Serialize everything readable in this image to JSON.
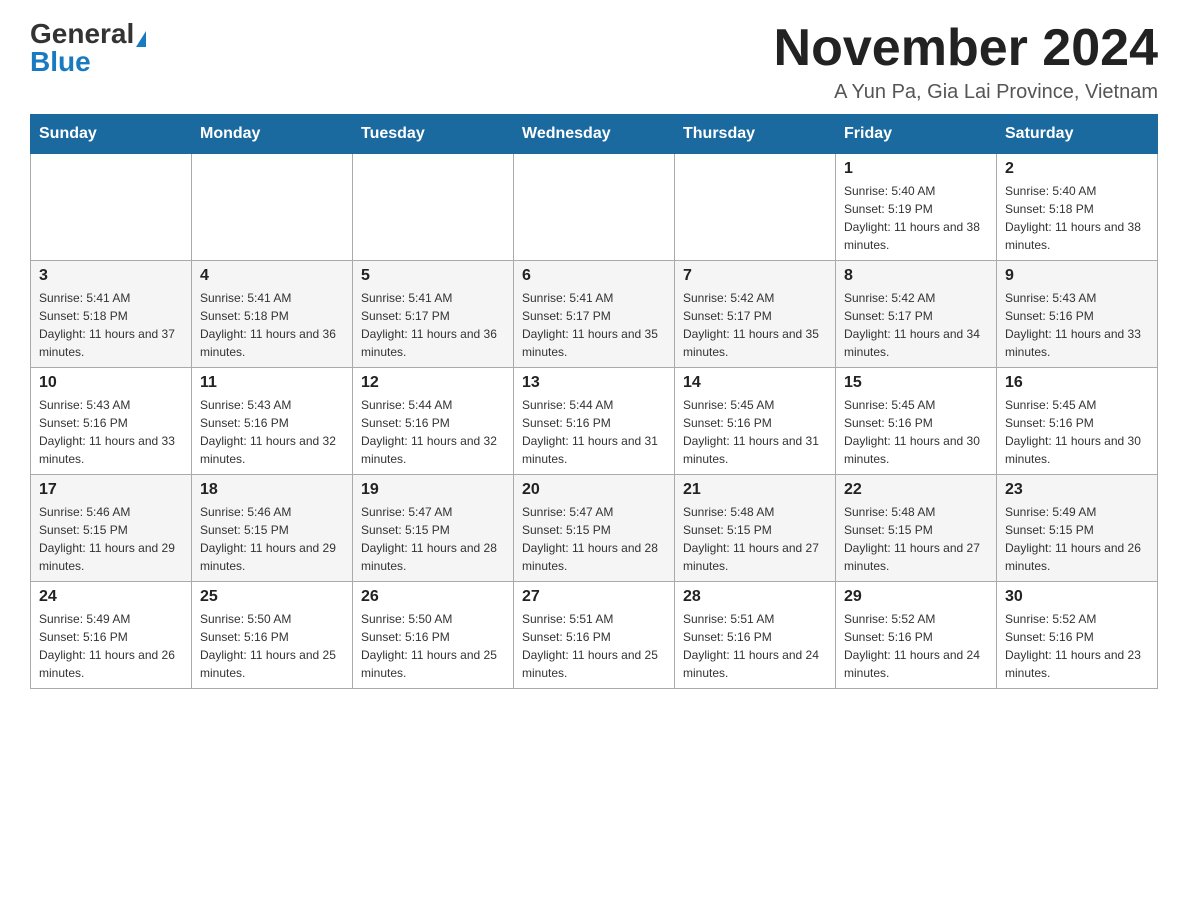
{
  "header": {
    "logo_general": "General",
    "logo_blue": "Blue",
    "month_title": "November 2024",
    "location": "A Yun Pa, Gia Lai Province, Vietnam"
  },
  "days_of_week": [
    "Sunday",
    "Monday",
    "Tuesday",
    "Wednesday",
    "Thursday",
    "Friday",
    "Saturday"
  ],
  "weeks": [
    [
      {
        "day": "",
        "info": ""
      },
      {
        "day": "",
        "info": ""
      },
      {
        "day": "",
        "info": ""
      },
      {
        "day": "",
        "info": ""
      },
      {
        "day": "",
        "info": ""
      },
      {
        "day": "1",
        "info": "Sunrise: 5:40 AM\nSunset: 5:19 PM\nDaylight: 11 hours and 38 minutes."
      },
      {
        "day": "2",
        "info": "Sunrise: 5:40 AM\nSunset: 5:18 PM\nDaylight: 11 hours and 38 minutes."
      }
    ],
    [
      {
        "day": "3",
        "info": "Sunrise: 5:41 AM\nSunset: 5:18 PM\nDaylight: 11 hours and 37 minutes."
      },
      {
        "day": "4",
        "info": "Sunrise: 5:41 AM\nSunset: 5:18 PM\nDaylight: 11 hours and 36 minutes."
      },
      {
        "day": "5",
        "info": "Sunrise: 5:41 AM\nSunset: 5:17 PM\nDaylight: 11 hours and 36 minutes."
      },
      {
        "day": "6",
        "info": "Sunrise: 5:41 AM\nSunset: 5:17 PM\nDaylight: 11 hours and 35 minutes."
      },
      {
        "day": "7",
        "info": "Sunrise: 5:42 AM\nSunset: 5:17 PM\nDaylight: 11 hours and 35 minutes."
      },
      {
        "day": "8",
        "info": "Sunrise: 5:42 AM\nSunset: 5:17 PM\nDaylight: 11 hours and 34 minutes."
      },
      {
        "day": "9",
        "info": "Sunrise: 5:43 AM\nSunset: 5:16 PM\nDaylight: 11 hours and 33 minutes."
      }
    ],
    [
      {
        "day": "10",
        "info": "Sunrise: 5:43 AM\nSunset: 5:16 PM\nDaylight: 11 hours and 33 minutes."
      },
      {
        "day": "11",
        "info": "Sunrise: 5:43 AM\nSunset: 5:16 PM\nDaylight: 11 hours and 32 minutes."
      },
      {
        "day": "12",
        "info": "Sunrise: 5:44 AM\nSunset: 5:16 PM\nDaylight: 11 hours and 32 minutes."
      },
      {
        "day": "13",
        "info": "Sunrise: 5:44 AM\nSunset: 5:16 PM\nDaylight: 11 hours and 31 minutes."
      },
      {
        "day": "14",
        "info": "Sunrise: 5:45 AM\nSunset: 5:16 PM\nDaylight: 11 hours and 31 minutes."
      },
      {
        "day": "15",
        "info": "Sunrise: 5:45 AM\nSunset: 5:16 PM\nDaylight: 11 hours and 30 minutes."
      },
      {
        "day": "16",
        "info": "Sunrise: 5:45 AM\nSunset: 5:16 PM\nDaylight: 11 hours and 30 minutes."
      }
    ],
    [
      {
        "day": "17",
        "info": "Sunrise: 5:46 AM\nSunset: 5:15 PM\nDaylight: 11 hours and 29 minutes."
      },
      {
        "day": "18",
        "info": "Sunrise: 5:46 AM\nSunset: 5:15 PM\nDaylight: 11 hours and 29 minutes."
      },
      {
        "day": "19",
        "info": "Sunrise: 5:47 AM\nSunset: 5:15 PM\nDaylight: 11 hours and 28 minutes."
      },
      {
        "day": "20",
        "info": "Sunrise: 5:47 AM\nSunset: 5:15 PM\nDaylight: 11 hours and 28 minutes."
      },
      {
        "day": "21",
        "info": "Sunrise: 5:48 AM\nSunset: 5:15 PM\nDaylight: 11 hours and 27 minutes."
      },
      {
        "day": "22",
        "info": "Sunrise: 5:48 AM\nSunset: 5:15 PM\nDaylight: 11 hours and 27 minutes."
      },
      {
        "day": "23",
        "info": "Sunrise: 5:49 AM\nSunset: 5:15 PM\nDaylight: 11 hours and 26 minutes."
      }
    ],
    [
      {
        "day": "24",
        "info": "Sunrise: 5:49 AM\nSunset: 5:16 PM\nDaylight: 11 hours and 26 minutes."
      },
      {
        "day": "25",
        "info": "Sunrise: 5:50 AM\nSunset: 5:16 PM\nDaylight: 11 hours and 25 minutes."
      },
      {
        "day": "26",
        "info": "Sunrise: 5:50 AM\nSunset: 5:16 PM\nDaylight: 11 hours and 25 minutes."
      },
      {
        "day": "27",
        "info": "Sunrise: 5:51 AM\nSunset: 5:16 PM\nDaylight: 11 hours and 25 minutes."
      },
      {
        "day": "28",
        "info": "Sunrise: 5:51 AM\nSunset: 5:16 PM\nDaylight: 11 hours and 24 minutes."
      },
      {
        "day": "29",
        "info": "Sunrise: 5:52 AM\nSunset: 5:16 PM\nDaylight: 11 hours and 24 minutes."
      },
      {
        "day": "30",
        "info": "Sunrise: 5:52 AM\nSunset: 5:16 PM\nDaylight: 11 hours and 23 minutes."
      }
    ]
  ]
}
